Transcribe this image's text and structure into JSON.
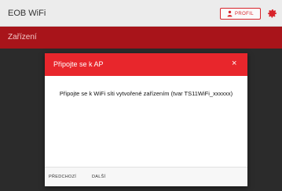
{
  "app": {
    "title": "EOB WiFi",
    "profile_label": "PROFIL"
  },
  "section": {
    "title": "Zařízení"
  },
  "dialog": {
    "title": "Připojte se k AP",
    "close_symbol": "×",
    "message": "Připojte se k WiFi síti vytvořené zařízením (tvar TS11WiFi_xxxxxx)",
    "prev_label": "PŘEDCHOZÍ",
    "next_label": "DALŠÍ"
  },
  "colors": {
    "brand_red": "#e8262c",
    "section_red": "#a8141a",
    "topbar_bg": "#ececec",
    "overlay_bg": "#2b2b2b"
  },
  "icons": [
    "person-icon",
    "gear-icon",
    "close-icon"
  ]
}
